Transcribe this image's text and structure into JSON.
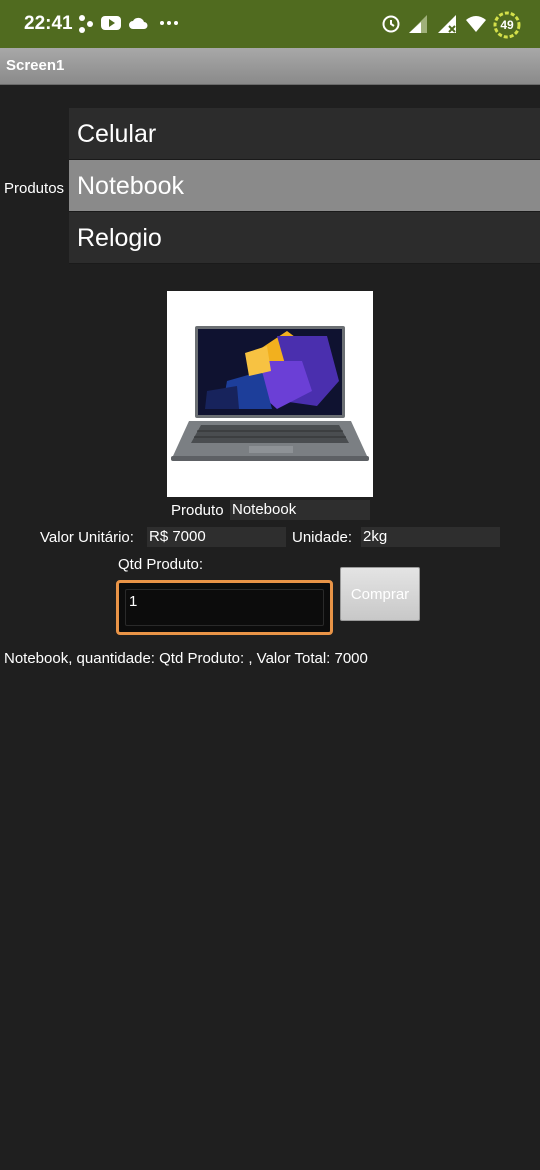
{
  "status_bar": {
    "time": "22:41",
    "battery": "49",
    "icons": [
      "share-icon",
      "youtube-icon",
      "cloud-icon",
      "more-dots-icon",
      "alarm-icon",
      "signal-icon",
      "signal-x-icon",
      "wifi-icon",
      "battery-icon"
    ]
  },
  "app": {
    "title": "Screen1"
  },
  "produtos": {
    "label": "Produtos",
    "items": [
      "Celular",
      "Notebook",
      "Relogio"
    ],
    "selected": "Notebook"
  },
  "produto": {
    "label": "Produto",
    "value": "Notebook"
  },
  "valor_unitario": {
    "label": "Valor Unitário:",
    "value": "R$ 7000"
  },
  "unidade": {
    "label": "Unidade:",
    "value": "2kg"
  },
  "qtd": {
    "label": "Qtd Produto:",
    "value": "1"
  },
  "comprar_label": "Comprar",
  "result_text": "Notebook, quantidade: Qtd Produto: , Valor Total: 7000",
  "colors": {
    "status_bar": "#506b1f",
    "background": "#1f1f1f",
    "input_border": "#e99447",
    "selected_item": "#8a8a8a"
  }
}
